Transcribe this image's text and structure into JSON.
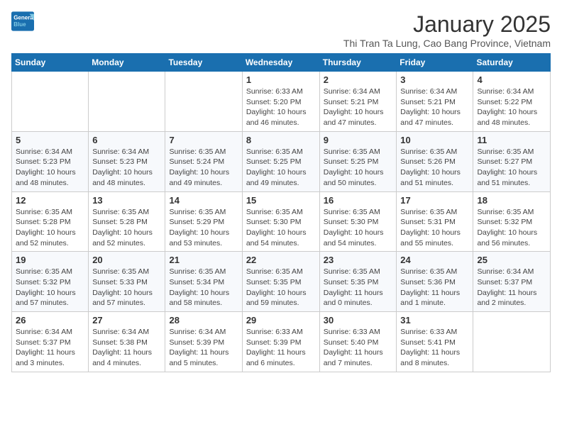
{
  "header": {
    "logo_general": "General",
    "logo_blue": "Blue",
    "title": "January 2025",
    "subtitle": "Thi Tran Ta Lung, Cao Bang Province, Vietnam"
  },
  "weekdays": [
    "Sunday",
    "Monday",
    "Tuesday",
    "Wednesday",
    "Thursday",
    "Friday",
    "Saturday"
  ],
  "weeks": [
    [
      {
        "day": "",
        "info": ""
      },
      {
        "day": "",
        "info": ""
      },
      {
        "day": "",
        "info": ""
      },
      {
        "day": "1",
        "info": "Sunrise: 6:33 AM\nSunset: 5:20 PM\nDaylight: 10 hours\nand 46 minutes."
      },
      {
        "day": "2",
        "info": "Sunrise: 6:34 AM\nSunset: 5:21 PM\nDaylight: 10 hours\nand 47 minutes."
      },
      {
        "day": "3",
        "info": "Sunrise: 6:34 AM\nSunset: 5:21 PM\nDaylight: 10 hours\nand 47 minutes."
      },
      {
        "day": "4",
        "info": "Sunrise: 6:34 AM\nSunset: 5:22 PM\nDaylight: 10 hours\nand 48 minutes."
      }
    ],
    [
      {
        "day": "5",
        "info": "Sunrise: 6:34 AM\nSunset: 5:23 PM\nDaylight: 10 hours\nand 48 minutes."
      },
      {
        "day": "6",
        "info": "Sunrise: 6:34 AM\nSunset: 5:23 PM\nDaylight: 10 hours\nand 48 minutes."
      },
      {
        "day": "7",
        "info": "Sunrise: 6:35 AM\nSunset: 5:24 PM\nDaylight: 10 hours\nand 49 minutes."
      },
      {
        "day": "8",
        "info": "Sunrise: 6:35 AM\nSunset: 5:25 PM\nDaylight: 10 hours\nand 49 minutes."
      },
      {
        "day": "9",
        "info": "Sunrise: 6:35 AM\nSunset: 5:25 PM\nDaylight: 10 hours\nand 50 minutes."
      },
      {
        "day": "10",
        "info": "Sunrise: 6:35 AM\nSunset: 5:26 PM\nDaylight: 10 hours\nand 51 minutes."
      },
      {
        "day": "11",
        "info": "Sunrise: 6:35 AM\nSunset: 5:27 PM\nDaylight: 10 hours\nand 51 minutes."
      }
    ],
    [
      {
        "day": "12",
        "info": "Sunrise: 6:35 AM\nSunset: 5:28 PM\nDaylight: 10 hours\nand 52 minutes."
      },
      {
        "day": "13",
        "info": "Sunrise: 6:35 AM\nSunset: 5:28 PM\nDaylight: 10 hours\nand 52 minutes."
      },
      {
        "day": "14",
        "info": "Sunrise: 6:35 AM\nSunset: 5:29 PM\nDaylight: 10 hours\nand 53 minutes."
      },
      {
        "day": "15",
        "info": "Sunrise: 6:35 AM\nSunset: 5:30 PM\nDaylight: 10 hours\nand 54 minutes."
      },
      {
        "day": "16",
        "info": "Sunrise: 6:35 AM\nSunset: 5:30 PM\nDaylight: 10 hours\nand 54 minutes."
      },
      {
        "day": "17",
        "info": "Sunrise: 6:35 AM\nSunset: 5:31 PM\nDaylight: 10 hours\nand 55 minutes."
      },
      {
        "day": "18",
        "info": "Sunrise: 6:35 AM\nSunset: 5:32 PM\nDaylight: 10 hours\nand 56 minutes."
      }
    ],
    [
      {
        "day": "19",
        "info": "Sunrise: 6:35 AM\nSunset: 5:32 PM\nDaylight: 10 hours\nand 57 minutes."
      },
      {
        "day": "20",
        "info": "Sunrise: 6:35 AM\nSunset: 5:33 PM\nDaylight: 10 hours\nand 57 minutes."
      },
      {
        "day": "21",
        "info": "Sunrise: 6:35 AM\nSunset: 5:34 PM\nDaylight: 10 hours\nand 58 minutes."
      },
      {
        "day": "22",
        "info": "Sunrise: 6:35 AM\nSunset: 5:35 PM\nDaylight: 10 hours\nand 59 minutes."
      },
      {
        "day": "23",
        "info": "Sunrise: 6:35 AM\nSunset: 5:35 PM\nDaylight: 11 hours\nand 0 minutes."
      },
      {
        "day": "24",
        "info": "Sunrise: 6:35 AM\nSunset: 5:36 PM\nDaylight: 11 hours\nand 1 minute."
      },
      {
        "day": "25",
        "info": "Sunrise: 6:34 AM\nSunset: 5:37 PM\nDaylight: 11 hours\nand 2 minutes."
      }
    ],
    [
      {
        "day": "26",
        "info": "Sunrise: 6:34 AM\nSunset: 5:37 PM\nDaylight: 11 hours\nand 3 minutes."
      },
      {
        "day": "27",
        "info": "Sunrise: 6:34 AM\nSunset: 5:38 PM\nDaylight: 11 hours\nand 4 minutes."
      },
      {
        "day": "28",
        "info": "Sunrise: 6:34 AM\nSunset: 5:39 PM\nDaylight: 11 hours\nand 5 minutes."
      },
      {
        "day": "29",
        "info": "Sunrise: 6:33 AM\nSunset: 5:39 PM\nDaylight: 11 hours\nand 6 minutes."
      },
      {
        "day": "30",
        "info": "Sunrise: 6:33 AM\nSunset: 5:40 PM\nDaylight: 11 hours\nand 7 minutes."
      },
      {
        "day": "31",
        "info": "Sunrise: 6:33 AM\nSunset: 5:41 PM\nDaylight: 11 hours\nand 8 minutes."
      },
      {
        "day": "",
        "info": ""
      }
    ]
  ]
}
